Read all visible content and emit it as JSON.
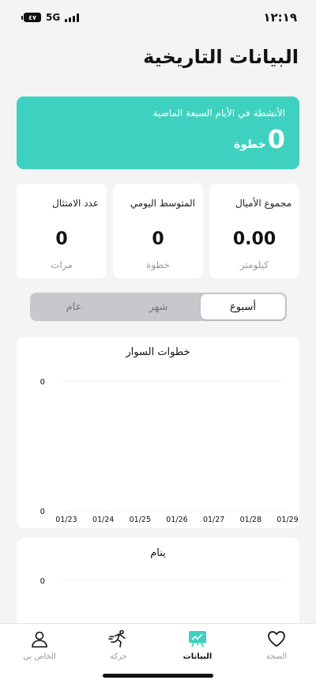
{
  "status_bar": {
    "time": "١٢:١٩",
    "network": "5G",
    "battery_level": "٤٧"
  },
  "page": {
    "title": "البيانات التاريخية"
  },
  "hero": {
    "caption": "الأنشطة في الأيام السبعة الماضية",
    "value": "0",
    "unit": "خطوة",
    "color": "#3fd1bf"
  },
  "stats": [
    {
      "label": "مجموع الأميال",
      "value": "0.00",
      "unit": "كيلومتر"
    },
    {
      "label": "المتوسط اليومي",
      "value": "0",
      "unit": "خطوة"
    },
    {
      "label": "عدد الامتثال",
      "value": "0",
      "unit": "مرات"
    }
  ],
  "segments": [
    {
      "label": "أسبوع",
      "selected": true
    },
    {
      "label": "شهر",
      "selected": false
    },
    {
      "label": "عام",
      "selected": false
    }
  ],
  "chart_data": [
    {
      "type": "line",
      "title": "خطوات السوار",
      "x": [
        "01/23",
        "01/24",
        "01/25",
        "01/26",
        "01/27",
        "01/28",
        "01/29"
      ],
      "series": [
        {
          "values": [
            0,
            0,
            0,
            0,
            0,
            0,
            0
          ]
        }
      ],
      "y_ticks": [
        "0",
        "0"
      ],
      "grid": false
    },
    {
      "type": "line",
      "title": "ينام",
      "x": [],
      "series": [],
      "y_ticks": [
        "0"
      ],
      "grid": false
    }
  ],
  "tabbar": {
    "items": [
      {
        "key": "profile",
        "label": "الخاص بي",
        "icon": "person-icon",
        "active": false
      },
      {
        "key": "activity",
        "label": "حركة",
        "icon": "running-icon",
        "active": false
      },
      {
        "key": "data",
        "label": "البيانات",
        "icon": "chart-board-icon",
        "active": true
      },
      {
        "key": "health",
        "label": "الصحة",
        "icon": "heart-icon",
        "active": false
      }
    ],
    "accent": "#3fd1bf"
  }
}
